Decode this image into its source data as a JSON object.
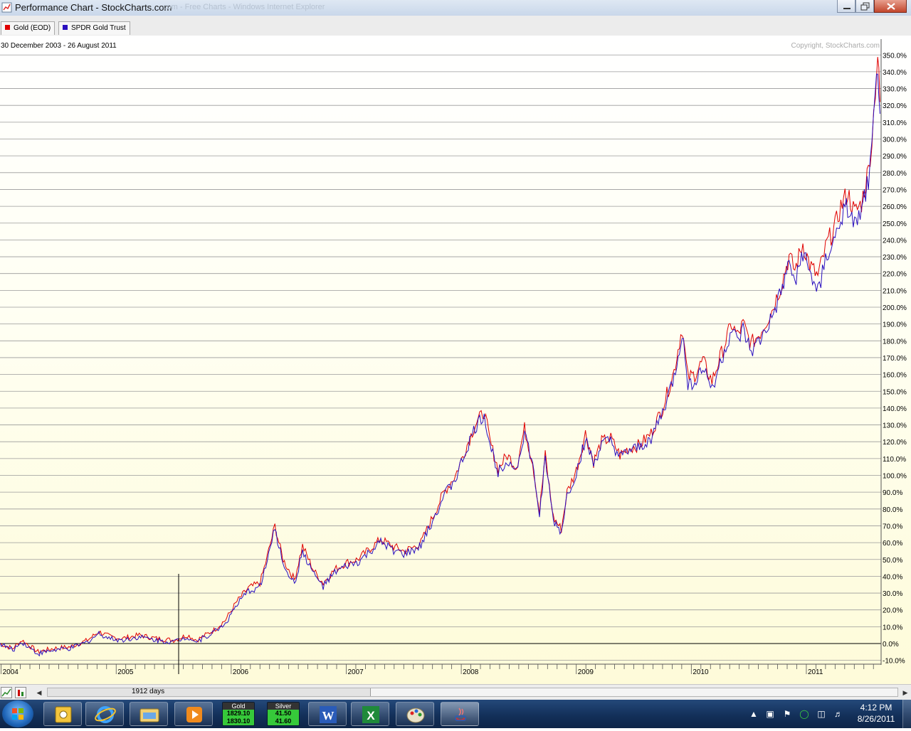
{
  "window": {
    "title": "Performance Chart - StockCharts.com",
    "title_faded": ".com - Free Charts - Windows Internet Explorer"
  },
  "legend": [
    {
      "label": "Gold (EOD)",
      "color": "#e00000"
    },
    {
      "label": "SPDR Gold Trust",
      "color": "#2a0fbf"
    }
  ],
  "chart": {
    "date_range": "30 December 2003 - 26 August 2011",
    "copyright": "Copyright, StockCharts.com",
    "days_label": "1912 days"
  },
  "chart_data": {
    "type": "line",
    "x_labels": [
      "2004",
      "2005",
      "2006",
      "2007",
      "2008",
      "2009",
      "2010",
      "2011"
    ],
    "y_ticks": [
      "350.0%",
      "340.0%",
      "330.0%",
      "320.0%",
      "310.0%",
      "300.0%",
      "290.0%",
      "280.0%",
      "270.0%",
      "260.0%",
      "250.0%",
      "240.0%",
      "230.0%",
      "220.0%",
      "210.0%",
      "200.0%",
      "190.0%",
      "180.0%",
      "170.0%",
      "160.0%",
      "150.0%",
      "140.0%",
      "130.0%",
      "120.0%",
      "110.0%",
      "100.0%",
      "90.0%",
      "80.0%",
      "70.0%",
      "60.0%",
      "50.0%",
      "40.0%",
      "30.0%",
      "20.0%",
      "10.0%",
      "0.0%",
      "-10.0%"
    ],
    "ylim": [
      -10,
      355
    ],
    "xlim": [
      2003.99,
      2011.65
    ],
    "y_unit": "%",
    "grid": true,
    "series": [
      {
        "name": "Gold (EOD)",
        "color": "#e00000",
        "points": [
          [
            2003.99,
            0
          ],
          [
            2004.1,
            -3
          ],
          [
            2004.18,
            2
          ],
          [
            2004.32,
            -5
          ],
          [
            2004.45,
            -3
          ],
          [
            2004.6,
            -2
          ],
          [
            2004.75,
            2
          ],
          [
            2004.85,
            7
          ],
          [
            2004.95,
            4
          ],
          [
            2005.05,
            3
          ],
          [
            2005.2,
            5
          ],
          [
            2005.35,
            3
          ],
          [
            2005.5,
            2
          ],
          [
            2005.62,
            5
          ],
          [
            2005.7,
            2
          ],
          [
            2005.85,
            8
          ],
          [
            2005.95,
            14
          ],
          [
            2006.05,
            25
          ],
          [
            2006.15,
            33
          ],
          [
            2006.25,
            36
          ],
          [
            2006.3,
            48
          ],
          [
            2006.38,
            70
          ],
          [
            2006.45,
            50
          ],
          [
            2006.55,
            38
          ],
          [
            2006.62,
            58
          ],
          [
            2006.72,
            43
          ],
          [
            2006.8,
            36
          ],
          [
            2006.9,
            44
          ],
          [
            2007.0,
            48
          ],
          [
            2007.1,
            50
          ],
          [
            2007.2,
            56
          ],
          [
            2007.3,
            62
          ],
          [
            2007.4,
            58
          ],
          [
            2007.5,
            55
          ],
          [
            2007.58,
            57
          ],
          [
            2007.65,
            60
          ],
          [
            2007.75,
            75
          ],
          [
            2007.85,
            90
          ],
          [
            2007.95,
            100
          ],
          [
            2008.05,
            118
          ],
          [
            2008.12,
            130
          ],
          [
            2008.2,
            138
          ],
          [
            2008.25,
            120
          ],
          [
            2008.32,
            104
          ],
          [
            2008.4,
            112
          ],
          [
            2008.48,
            105
          ],
          [
            2008.55,
            128
          ],
          [
            2008.62,
            108
          ],
          [
            2008.68,
            78
          ],
          [
            2008.73,
            112
          ],
          [
            2008.8,
            75
          ],
          [
            2008.87,
            68
          ],
          [
            2008.92,
            90
          ],
          [
            2009.0,
            103
          ],
          [
            2009.08,
            125
          ],
          [
            2009.15,
            108
          ],
          [
            2009.22,
            120
          ],
          [
            2009.3,
            122
          ],
          [
            2009.38,
            112
          ],
          [
            2009.45,
            116
          ],
          [
            2009.55,
            118
          ],
          [
            2009.65,
            125
          ],
          [
            2009.75,
            140
          ],
          [
            2009.85,
            162
          ],
          [
            2009.92,
            188
          ],
          [
            2009.97,
            158
          ],
          [
            2010.03,
            160
          ],
          [
            2010.1,
            168
          ],
          [
            2010.18,
            156
          ],
          [
            2010.25,
            170
          ],
          [
            2010.35,
            190
          ],
          [
            2010.4,
            183
          ],
          [
            2010.45,
            190
          ],
          [
            2010.52,
            178
          ],
          [
            2010.6,
            185
          ],
          [
            2010.7,
            198
          ],
          [
            2010.78,
            213
          ],
          [
            2010.85,
            230
          ],
          [
            2010.9,
            222
          ],
          [
            2010.97,
            238
          ],
          [
            2011.03,
            225
          ],
          [
            2011.1,
            218
          ],
          [
            2011.18,
            238
          ],
          [
            2011.25,
            248
          ],
          [
            2011.3,
            260
          ],
          [
            2011.36,
            268
          ],
          [
            2011.42,
            256
          ],
          [
            2011.48,
            262
          ],
          [
            2011.54,
            282
          ],
          [
            2011.57,
            300
          ],
          [
            2011.6,
            330
          ],
          [
            2011.62,
            350
          ],
          [
            2011.64,
            322
          ]
        ]
      },
      {
        "name": "SPDR Gold Trust",
        "color": "#2a0fbf",
        "points": [
          [
            2003.99,
            0
          ],
          [
            2004.1,
            -4
          ],
          [
            2004.18,
            1
          ],
          [
            2004.32,
            -6
          ],
          [
            2004.45,
            -4
          ],
          [
            2004.6,
            -3
          ],
          [
            2004.75,
            1
          ],
          [
            2004.85,
            6
          ],
          [
            2004.95,
            3
          ],
          [
            2005.05,
            2
          ],
          [
            2005.2,
            4
          ],
          [
            2005.35,
            2
          ],
          [
            2005.5,
            1
          ],
          [
            2005.62,
            4
          ],
          [
            2005.7,
            1
          ],
          [
            2005.85,
            7
          ],
          [
            2005.95,
            12
          ],
          [
            2006.05,
            23
          ],
          [
            2006.15,
            31
          ],
          [
            2006.25,
            34
          ],
          [
            2006.3,
            46
          ],
          [
            2006.38,
            68
          ],
          [
            2006.45,
            48
          ],
          [
            2006.55,
            35
          ],
          [
            2006.62,
            55
          ],
          [
            2006.72,
            41
          ],
          [
            2006.8,
            34
          ],
          [
            2006.9,
            42
          ],
          [
            2007.0,
            46
          ],
          [
            2007.1,
            48
          ],
          [
            2007.2,
            54
          ],
          [
            2007.3,
            60
          ],
          [
            2007.4,
            56
          ],
          [
            2007.5,
            53
          ],
          [
            2007.58,
            55
          ],
          [
            2007.65,
            58
          ],
          [
            2007.75,
            73
          ],
          [
            2007.85,
            88
          ],
          [
            2007.95,
            98
          ],
          [
            2008.05,
            116
          ],
          [
            2008.12,
            128
          ],
          [
            2008.2,
            136
          ],
          [
            2008.25,
            118
          ],
          [
            2008.32,
            102
          ],
          [
            2008.4,
            110
          ],
          [
            2008.48,
            103
          ],
          [
            2008.55,
            126
          ],
          [
            2008.62,
            106
          ],
          [
            2008.68,
            76
          ],
          [
            2008.73,
            110
          ],
          [
            2008.8,
            73
          ],
          [
            2008.87,
            66
          ],
          [
            2008.92,
            88
          ],
          [
            2009.0,
            101
          ],
          [
            2009.08,
            122
          ],
          [
            2009.15,
            106
          ],
          [
            2009.22,
            118
          ],
          [
            2009.3,
            120
          ],
          [
            2009.38,
            110
          ],
          [
            2009.45,
            114
          ],
          [
            2009.55,
            116
          ],
          [
            2009.65,
            122
          ],
          [
            2009.75,
            137
          ],
          [
            2009.85,
            158
          ],
          [
            2009.92,
            184
          ],
          [
            2009.97,
            154
          ],
          [
            2010.03,
            156
          ],
          [
            2010.1,
            164
          ],
          [
            2010.18,
            152
          ],
          [
            2010.25,
            166
          ],
          [
            2010.35,
            186
          ],
          [
            2010.4,
            179
          ],
          [
            2010.45,
            186
          ],
          [
            2010.52,
            173
          ],
          [
            2010.6,
            180
          ],
          [
            2010.7,
            193
          ],
          [
            2010.78,
            208
          ],
          [
            2010.85,
            225
          ],
          [
            2010.9,
            216
          ],
          [
            2010.97,
            232
          ],
          [
            2011.03,
            219
          ],
          [
            2011.1,
            210
          ],
          [
            2011.18,
            230
          ],
          [
            2011.25,
            240
          ],
          [
            2011.3,
            252
          ],
          [
            2011.36,
            260
          ],
          [
            2011.42,
            248
          ],
          [
            2011.48,
            255
          ],
          [
            2011.54,
            276
          ],
          [
            2011.57,
            294
          ],
          [
            2011.6,
            322
          ],
          [
            2011.62,
            344
          ],
          [
            2011.64,
            315
          ]
        ]
      }
    ]
  },
  "taskbar": {
    "gadgets": [
      {
        "name": "Gold",
        "bid": "1829.10",
        "ask": "1830.10"
      },
      {
        "name": "Silver",
        "bid": "41.50",
        "ask": "41.60"
      }
    ],
    "clock": {
      "time": "4:12 PM",
      "date": "8/26/2011"
    }
  }
}
